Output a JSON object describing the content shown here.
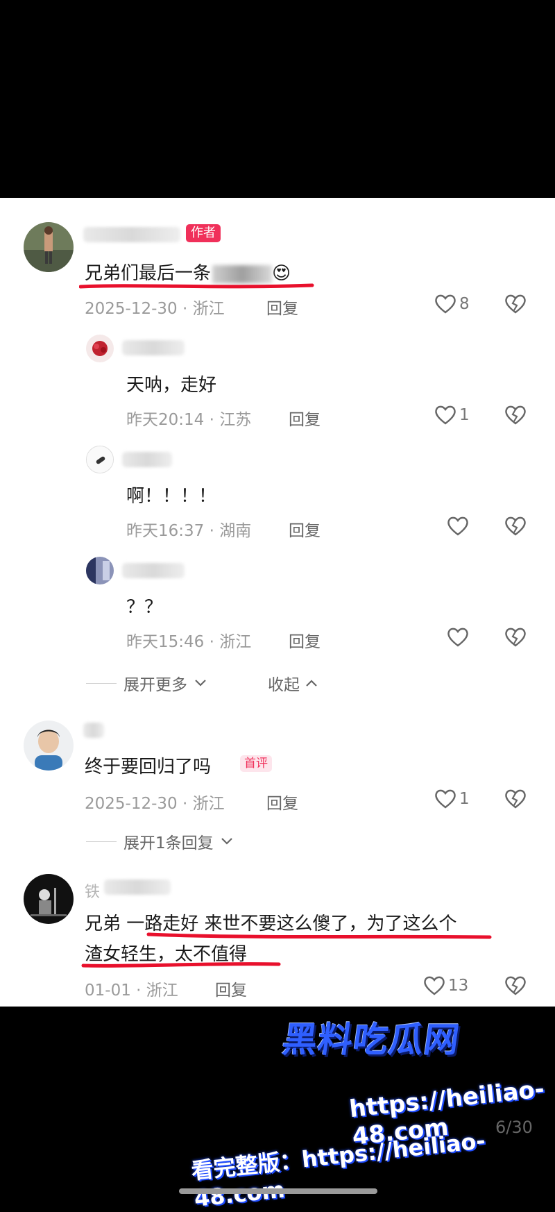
{
  "badges": {
    "author": "作者",
    "first_comment": "首评"
  },
  "reply_label": "回复",
  "comments": [
    {
      "text": "兄弟们最后一条",
      "emoji": "😍",
      "date": "2025-12-30",
      "location": "浙江",
      "likes": "8",
      "replies": [
        {
          "text": "天呐，走好",
          "date": "昨天20:14",
          "location": "江苏",
          "likes": "1"
        },
        {
          "text": "啊！！！！",
          "date": "昨天16:37",
          "location": "湖南",
          "likes": ""
        },
        {
          "text": "？？",
          "date": "昨天15:46",
          "location": "浙江",
          "likes": ""
        }
      ],
      "expand_more": "展开更多",
      "collapse": "收起"
    },
    {
      "text": "终于要回归了吗",
      "date": "2025-12-30",
      "location": "浙江",
      "likes": "1",
      "expand_replies": "展开1条回复"
    },
    {
      "username_visible": "铁",
      "text_line1": "兄弟 一路走好 来世不要这么傻了，为了这么个",
      "text_line2": "渣女轻生，太不值得",
      "date": "01-01",
      "location": "浙江",
      "likes": "13"
    }
  ],
  "meta_separator": " · ",
  "watermark": {
    "logo": "黑料吃瓜网",
    "url": "https://heiliao-48.com",
    "full_prefix": "看完整版：",
    "full_url": "https://heiliao-48.com"
  },
  "page_indicator": "6/30",
  "colors": {
    "accent_red": "#f0305a",
    "underline_red": "#e8102c",
    "watermark_blue": "#2f5fff"
  }
}
